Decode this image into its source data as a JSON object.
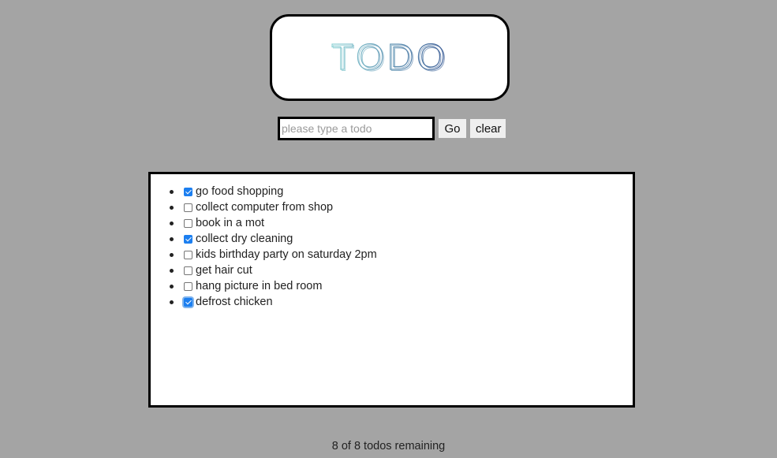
{
  "logo": {
    "text": "TODO",
    "colors": [
      "#7ec8cf",
      "#4a6fa5"
    ]
  },
  "entry": {
    "placeholder": "please type a todo",
    "value": "",
    "go_label": "Go",
    "clear_label": "clear"
  },
  "todos": [
    {
      "label": "go food shopping",
      "checked": true
    },
    {
      "label": "collect computer from shop",
      "checked": false
    },
    {
      "label": "book in a mot",
      "checked": false
    },
    {
      "label": "collect dry cleaning",
      "checked": true
    },
    {
      "label": "kids birthday party on saturday 2pm",
      "checked": false
    },
    {
      "label": "get hair cut",
      "checked": false
    },
    {
      "label": "hang picture in bed room",
      "checked": false
    },
    {
      "label": "defrost chicken",
      "checked": true,
      "focused": true
    }
  ],
  "status": {
    "text": "8 of 8 todos remaining"
  },
  "colors": {
    "background": "#a4a4a4",
    "checkbox_checked": "#1c7ff0"
  }
}
